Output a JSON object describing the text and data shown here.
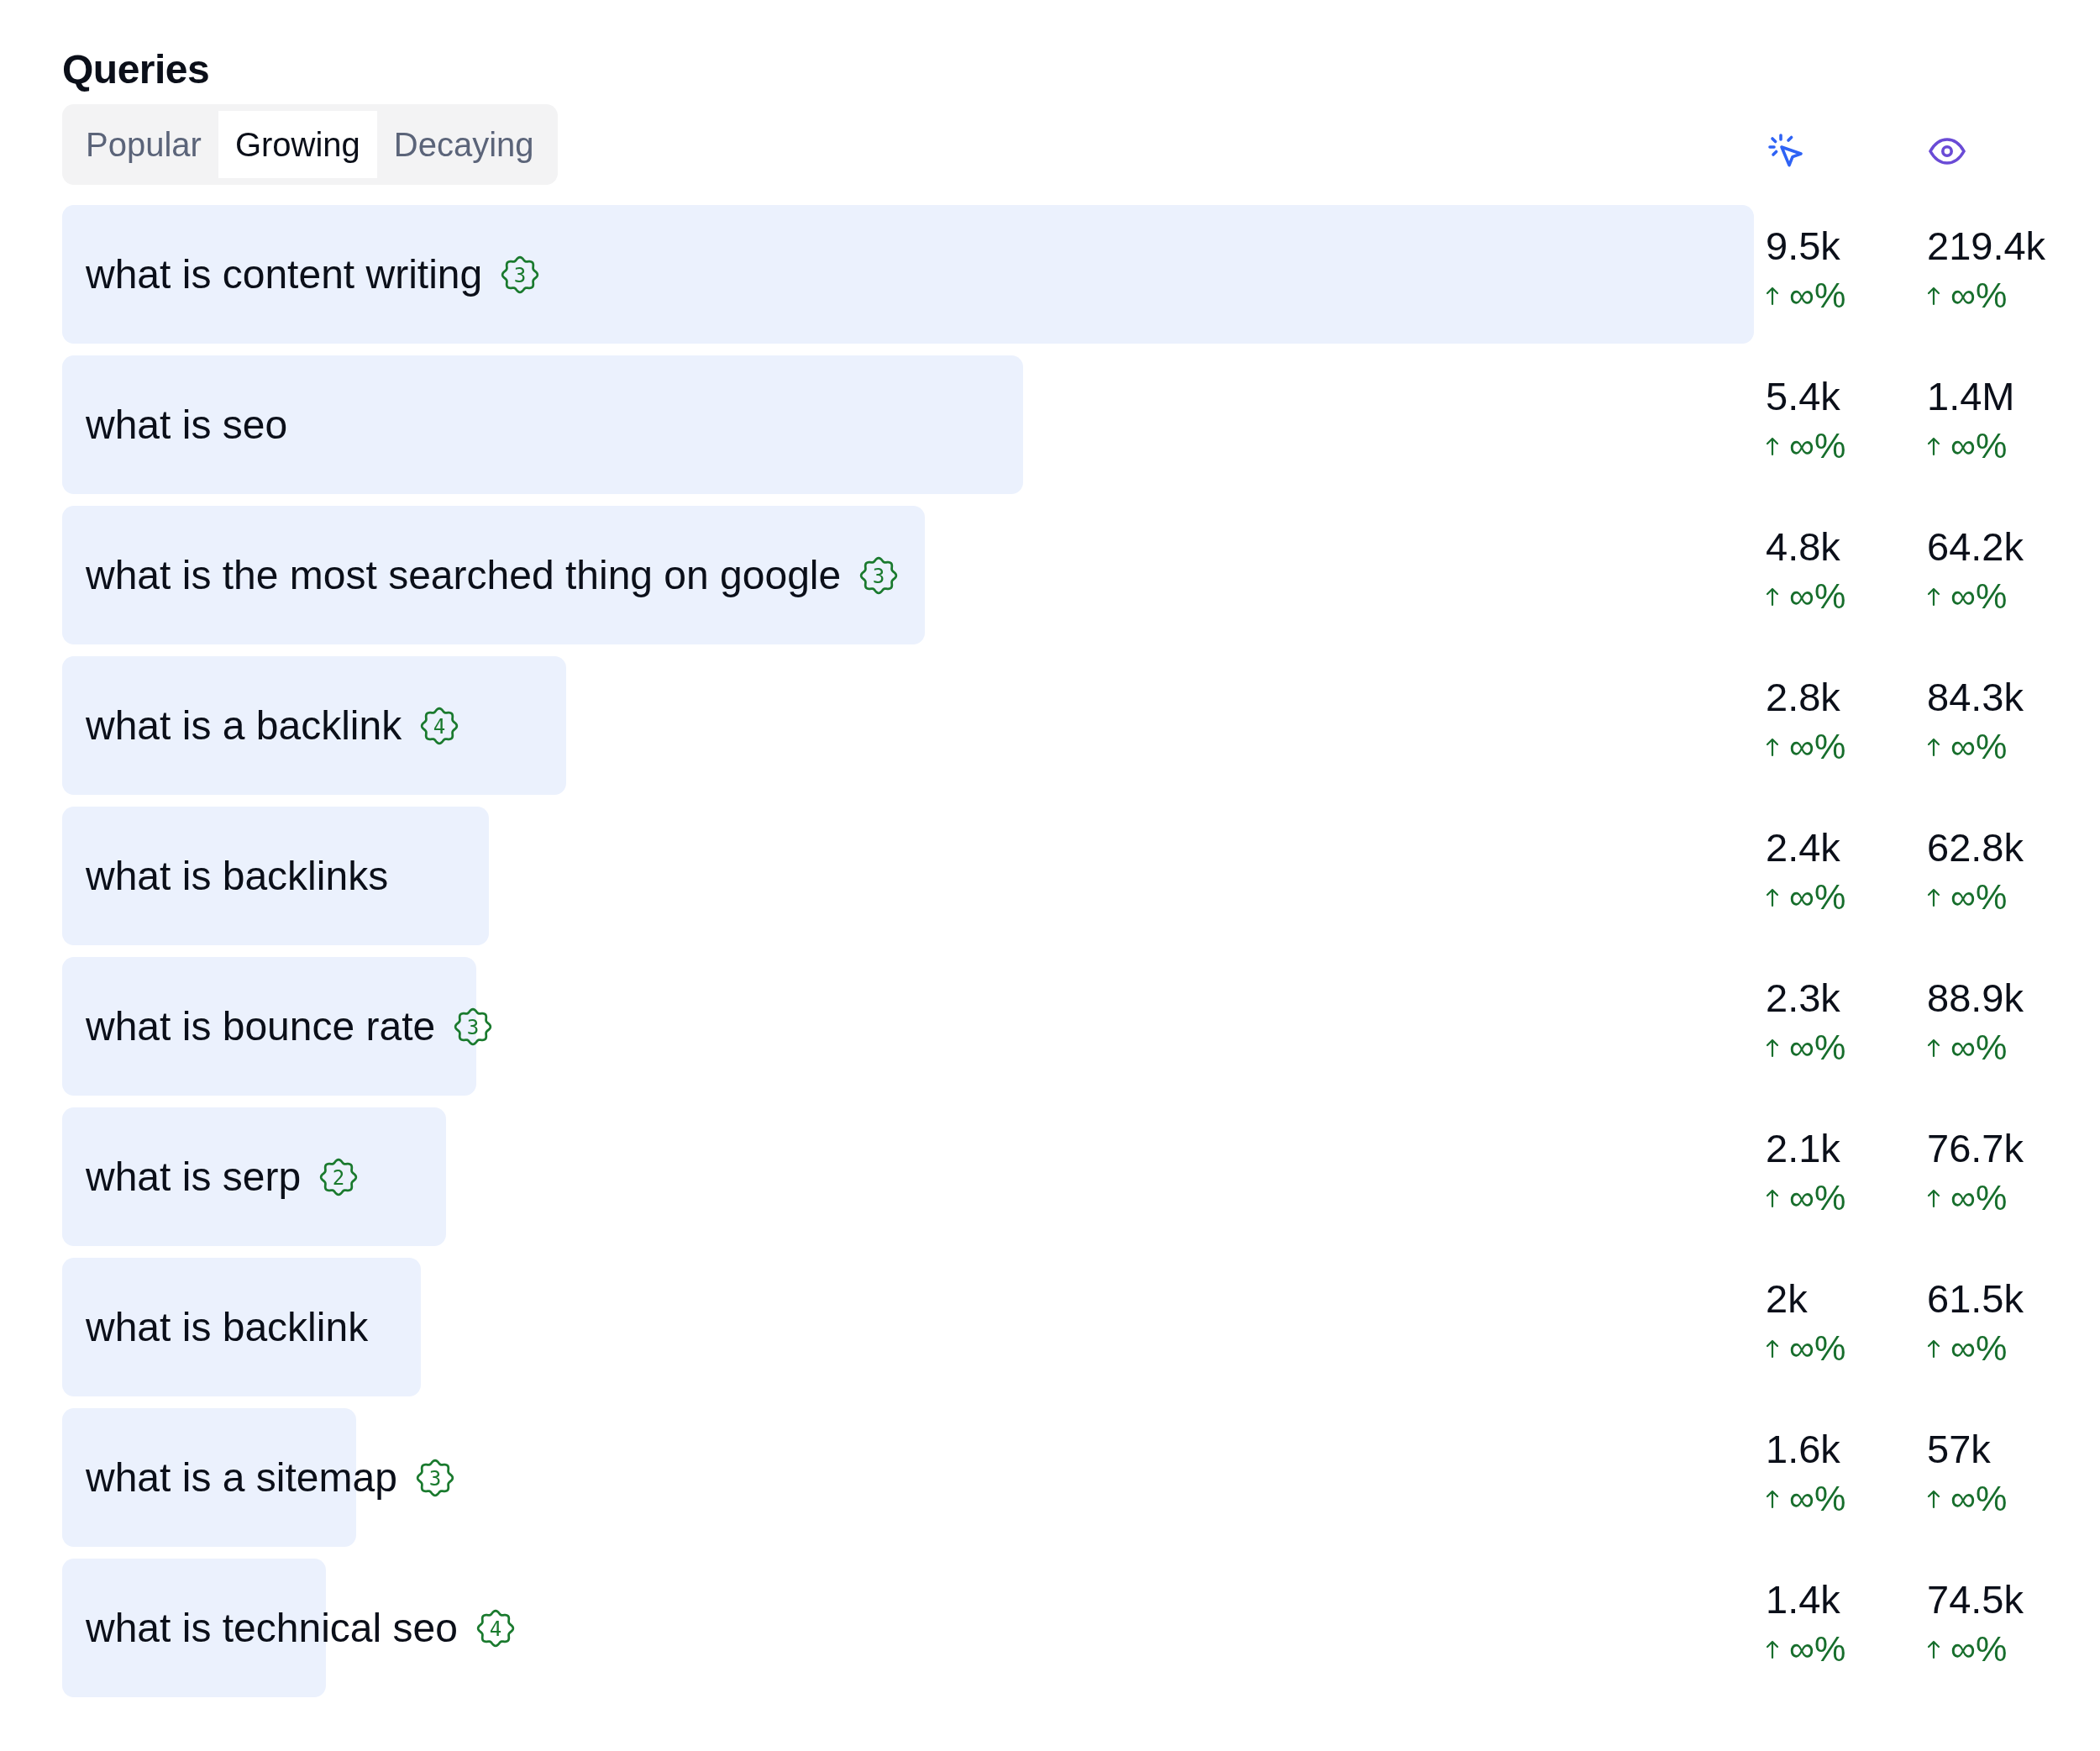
{
  "title": "Queries",
  "tabs": [
    {
      "label": "Popular",
      "selected": false
    },
    {
      "label": "Growing",
      "selected": true
    },
    {
      "label": "Decaying",
      "selected": false
    }
  ],
  "rows": [
    {
      "query": "what is content writing",
      "badge": "3",
      "clicks": {
        "value": "9.5k",
        "change": "∞%"
      },
      "impressions": {
        "value": "219.4k",
        "change": "∞%"
      }
    },
    {
      "query": "what is seo",
      "clicks": {
        "value": "5.4k",
        "change": "∞%"
      },
      "impressions": {
        "value": "1.4M",
        "change": "∞%"
      }
    },
    {
      "query": "what is the most searched thing on google",
      "badge": "3",
      "clicks": {
        "value": "4.8k",
        "change": "∞%"
      },
      "impressions": {
        "value": "64.2k",
        "change": "∞%"
      }
    },
    {
      "query": "what is a backlink",
      "badge": "4",
      "clicks": {
        "value": "2.8k",
        "change": "∞%"
      },
      "impressions": {
        "value": "84.3k",
        "change": "∞%"
      }
    },
    {
      "query": "what is backlinks",
      "clicks": {
        "value": "2.4k",
        "change": "∞%"
      },
      "impressions": {
        "value": "62.8k",
        "change": "∞%"
      }
    },
    {
      "query": "what is bounce rate",
      "badge": "3",
      "clicks": {
        "value": "2.3k",
        "change": "∞%"
      },
      "impressions": {
        "value": "88.9k",
        "change": "∞%"
      }
    },
    {
      "query": "what is serp",
      "badge": "2",
      "clicks": {
        "value": "2.1k",
        "change": "∞%"
      },
      "impressions": {
        "value": "76.7k",
        "change": "∞%"
      }
    },
    {
      "query": "what is backlink",
      "clicks": {
        "value": "2k",
        "change": "∞%"
      },
      "impressions": {
        "value": "61.5k",
        "change": "∞%"
      }
    },
    {
      "query": "what is a sitemap",
      "badge": "3",
      "clicks": {
        "value": "1.6k",
        "change": "∞%"
      },
      "impressions": {
        "value": "57k",
        "change": "∞%"
      }
    },
    {
      "query": "what is technical seo",
      "badge": "4",
      "clicks": {
        "value": "1.4k",
        "change": "∞%"
      },
      "impressions": {
        "value": "74.5k",
        "change": "∞%"
      }
    }
  ]
}
